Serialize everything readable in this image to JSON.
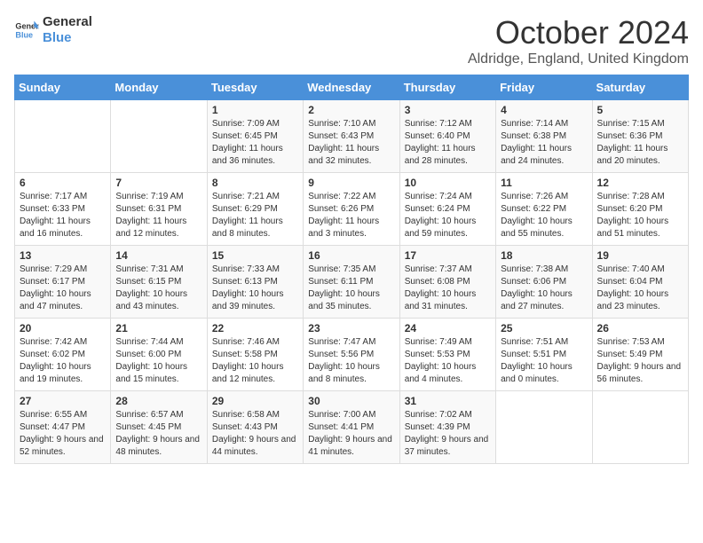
{
  "logo": {
    "line1": "General",
    "line2": "Blue"
  },
  "title": "October 2024",
  "location": "Aldridge, England, United Kingdom",
  "days_of_week": [
    "Sunday",
    "Monday",
    "Tuesday",
    "Wednesday",
    "Thursday",
    "Friday",
    "Saturday"
  ],
  "weeks": [
    [
      {
        "day": "",
        "content": ""
      },
      {
        "day": "",
        "content": ""
      },
      {
        "day": "1",
        "content": "Sunrise: 7:09 AM\nSunset: 6:45 PM\nDaylight: 11 hours and 36 minutes."
      },
      {
        "day": "2",
        "content": "Sunrise: 7:10 AM\nSunset: 6:43 PM\nDaylight: 11 hours and 32 minutes."
      },
      {
        "day": "3",
        "content": "Sunrise: 7:12 AM\nSunset: 6:40 PM\nDaylight: 11 hours and 28 minutes."
      },
      {
        "day": "4",
        "content": "Sunrise: 7:14 AM\nSunset: 6:38 PM\nDaylight: 11 hours and 24 minutes."
      },
      {
        "day": "5",
        "content": "Sunrise: 7:15 AM\nSunset: 6:36 PM\nDaylight: 11 hours and 20 minutes."
      }
    ],
    [
      {
        "day": "6",
        "content": "Sunrise: 7:17 AM\nSunset: 6:33 PM\nDaylight: 11 hours and 16 minutes."
      },
      {
        "day": "7",
        "content": "Sunrise: 7:19 AM\nSunset: 6:31 PM\nDaylight: 11 hours and 12 minutes."
      },
      {
        "day": "8",
        "content": "Sunrise: 7:21 AM\nSunset: 6:29 PM\nDaylight: 11 hours and 8 minutes."
      },
      {
        "day": "9",
        "content": "Sunrise: 7:22 AM\nSunset: 6:26 PM\nDaylight: 11 hours and 3 minutes."
      },
      {
        "day": "10",
        "content": "Sunrise: 7:24 AM\nSunset: 6:24 PM\nDaylight: 10 hours and 59 minutes."
      },
      {
        "day": "11",
        "content": "Sunrise: 7:26 AM\nSunset: 6:22 PM\nDaylight: 10 hours and 55 minutes."
      },
      {
        "day": "12",
        "content": "Sunrise: 7:28 AM\nSunset: 6:20 PM\nDaylight: 10 hours and 51 minutes."
      }
    ],
    [
      {
        "day": "13",
        "content": "Sunrise: 7:29 AM\nSunset: 6:17 PM\nDaylight: 10 hours and 47 minutes."
      },
      {
        "day": "14",
        "content": "Sunrise: 7:31 AM\nSunset: 6:15 PM\nDaylight: 10 hours and 43 minutes."
      },
      {
        "day": "15",
        "content": "Sunrise: 7:33 AM\nSunset: 6:13 PM\nDaylight: 10 hours and 39 minutes."
      },
      {
        "day": "16",
        "content": "Sunrise: 7:35 AM\nSunset: 6:11 PM\nDaylight: 10 hours and 35 minutes."
      },
      {
        "day": "17",
        "content": "Sunrise: 7:37 AM\nSunset: 6:08 PM\nDaylight: 10 hours and 31 minutes."
      },
      {
        "day": "18",
        "content": "Sunrise: 7:38 AM\nSunset: 6:06 PM\nDaylight: 10 hours and 27 minutes."
      },
      {
        "day": "19",
        "content": "Sunrise: 7:40 AM\nSunset: 6:04 PM\nDaylight: 10 hours and 23 minutes."
      }
    ],
    [
      {
        "day": "20",
        "content": "Sunrise: 7:42 AM\nSunset: 6:02 PM\nDaylight: 10 hours and 19 minutes."
      },
      {
        "day": "21",
        "content": "Sunrise: 7:44 AM\nSunset: 6:00 PM\nDaylight: 10 hours and 15 minutes."
      },
      {
        "day": "22",
        "content": "Sunrise: 7:46 AM\nSunset: 5:58 PM\nDaylight: 10 hours and 12 minutes."
      },
      {
        "day": "23",
        "content": "Sunrise: 7:47 AM\nSunset: 5:56 PM\nDaylight: 10 hours and 8 minutes."
      },
      {
        "day": "24",
        "content": "Sunrise: 7:49 AM\nSunset: 5:53 PM\nDaylight: 10 hours and 4 minutes."
      },
      {
        "day": "25",
        "content": "Sunrise: 7:51 AM\nSunset: 5:51 PM\nDaylight: 10 hours and 0 minutes."
      },
      {
        "day": "26",
        "content": "Sunrise: 7:53 AM\nSunset: 5:49 PM\nDaylight: 9 hours and 56 minutes."
      }
    ],
    [
      {
        "day": "27",
        "content": "Sunrise: 6:55 AM\nSunset: 4:47 PM\nDaylight: 9 hours and 52 minutes."
      },
      {
        "day": "28",
        "content": "Sunrise: 6:57 AM\nSunset: 4:45 PM\nDaylight: 9 hours and 48 minutes."
      },
      {
        "day": "29",
        "content": "Sunrise: 6:58 AM\nSunset: 4:43 PM\nDaylight: 9 hours and 44 minutes."
      },
      {
        "day": "30",
        "content": "Sunrise: 7:00 AM\nSunset: 4:41 PM\nDaylight: 9 hours and 41 minutes."
      },
      {
        "day": "31",
        "content": "Sunrise: 7:02 AM\nSunset: 4:39 PM\nDaylight: 9 hours and 37 minutes."
      },
      {
        "day": "",
        "content": ""
      },
      {
        "day": "",
        "content": ""
      }
    ]
  ]
}
